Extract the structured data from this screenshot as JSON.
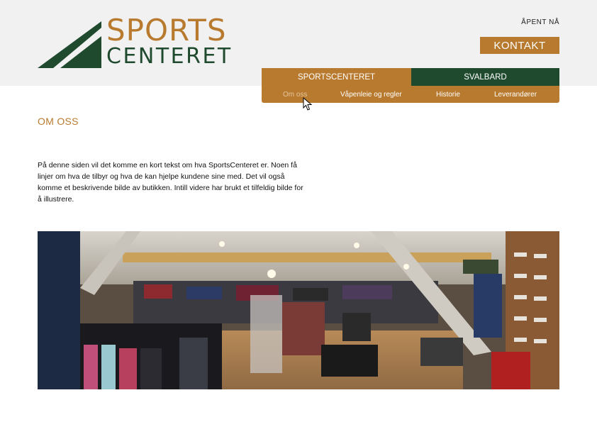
{
  "brand": {
    "line1": "SPORTS",
    "line2": "CENTERET",
    "colors": {
      "orange": "#b87a2e",
      "green": "#1f4a2e"
    }
  },
  "header": {
    "open_status": "ÅPENT NÅ",
    "contact_label": "KONTAKT"
  },
  "nav": {
    "tabs": [
      {
        "label": "SPORTSCENTERET"
      },
      {
        "label": "SVALBARD"
      }
    ],
    "subitems": [
      {
        "label": "Om oss",
        "active": true
      },
      {
        "label": "Våpenleie og regler"
      },
      {
        "label": "Historie"
      },
      {
        "label": "Leverandører"
      }
    ]
  },
  "main": {
    "title": "OM OSS",
    "intro": "På denne siden vil det komme en kort tekst om hva SportsCenteret er. Noen få linjer om hva de tilbyr og hva de kan hjelpe kundene sine med. Det vil også komme et beskrivende bilde av butikken. Intill videre har brukt et tilfeldig bilde for å illustrere."
  },
  "icons": {
    "logo": "triangles-logo-icon",
    "cursor": "mouse-pointer-icon"
  }
}
